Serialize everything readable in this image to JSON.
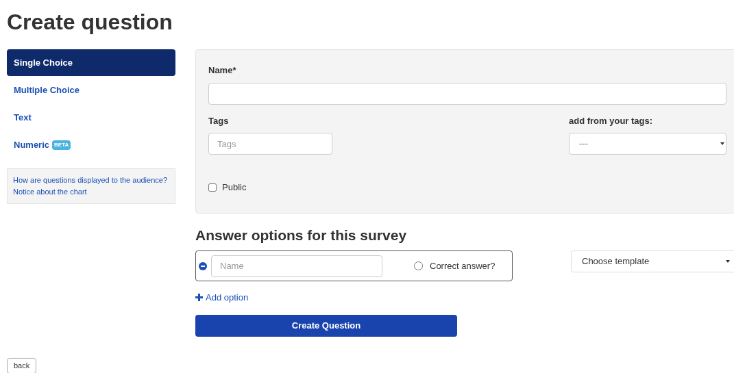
{
  "page_title": "Create question",
  "sidebar": {
    "items": [
      {
        "label": "Single Choice",
        "selected": true
      },
      {
        "label": "Multiple Choice",
        "selected": false
      },
      {
        "label": "Text",
        "selected": false
      },
      {
        "label": "Numeric",
        "selected": false,
        "badge": "BETA"
      }
    ],
    "help_links": [
      "How are questions displayed to the audience?",
      "Notice about the chart"
    ]
  },
  "form": {
    "name_label": "Name*",
    "tags_label": "Tags",
    "tags_placeholder": "Tags",
    "add_tags_label": "add from your tags:",
    "add_tags_value": "---",
    "public": {
      "label": "Public",
      "checked": false
    }
  },
  "answers": {
    "heading": "Answer options for this survey",
    "options": [
      {
        "placeholder": "Name",
        "correct_label": "Correct answer?",
        "correct": false
      }
    ],
    "template_value": "Choose template",
    "add_option": "Add option",
    "submit": "Create Question"
  },
  "back": "back"
}
